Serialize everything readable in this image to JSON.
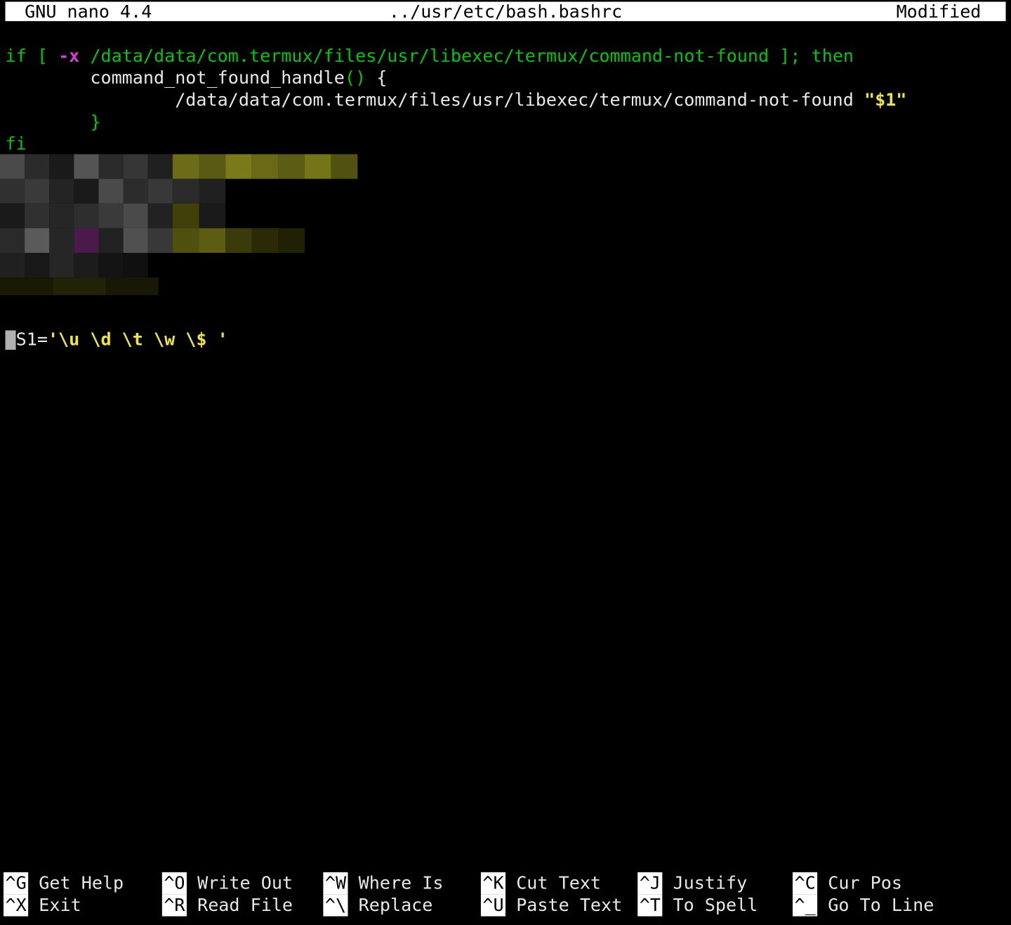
{
  "title": {
    "left": "GNU nano 4.4",
    "center": "../usr/etc/bash.bashrc",
    "right": "Modified"
  },
  "code": {
    "line1_if": "if",
    "line1_bracket_open": " [ ",
    "line1_flag": "-x",
    "line1_path": " /data/data/com.termux/files/usr/libexec/termux/command-not-found ",
    "line1_bracket_close": "]; ",
    "line1_then": "then",
    "line2_indent": "        ",
    "line2_fn": "command_not_found_handle",
    "line2_paren": "()",
    "line2_brace": " {",
    "line3_indent": "                ",
    "line3_cmd": "/data/data/com.termux/files/usr/libexec/termux/command-not-found ",
    "line3_arg": "\"$1\"",
    "line4_indent": "        ",
    "line4_brace": "}",
    "line5_fi": "fi",
    "ps1_lhs": "PS1",
    "ps1_eq": "=",
    "ps1_rhs": "'\\u \\d \\t \\w \\$ '"
  },
  "shortcuts_row1": [
    {
      "key": "^G",
      "label": "Get Help"
    },
    {
      "key": "^O",
      "label": "Write Out"
    },
    {
      "key": "^W",
      "label": "Where Is"
    },
    {
      "key": "^K",
      "label": "Cut Text"
    },
    {
      "key": "^J",
      "label": "Justify"
    },
    {
      "key": "^C",
      "label": "Cur Pos"
    }
  ],
  "shortcuts_row2": [
    {
      "key": "^X",
      "label": "Exit"
    },
    {
      "key": "^R",
      "label": "Read File"
    },
    {
      "key": "^\\",
      "label": "Replace"
    },
    {
      "key": "^U",
      "label": "Paste Text"
    },
    {
      "key": "^T",
      "label": "To Spell"
    },
    {
      "key": "^_",
      "label": "Go To Line"
    }
  ]
}
